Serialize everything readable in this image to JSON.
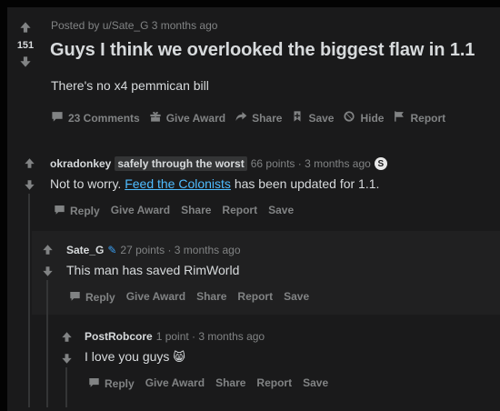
{
  "post": {
    "score": "151",
    "meta": "Posted by u/Sate_G 3 months ago",
    "title": "Guys I think we overlooked the biggest flaw in 1.1",
    "body": "There's no x4 pemmican bill",
    "actions": {
      "comments": "23 Comments",
      "award": "Give Award",
      "share": "Share",
      "save": "Save",
      "hide": "Hide",
      "report": "Report"
    }
  },
  "comments": [
    {
      "user": "okradonkey",
      "flair": "safely through the worst",
      "meta": "66 points · 3 months ago",
      "badge": "S",
      "text_before": "Not to worry. ",
      "link_text": "Feed the Colonists",
      "text_after": " has been updated for 1.1.",
      "actions": {
        "reply": "Reply",
        "award": "Give Award",
        "share": "Share",
        "report": "Report",
        "save": "Save"
      }
    },
    {
      "user": "Sate_G",
      "meta": "27 points · 3 months ago",
      "text": "This man has saved RimWorld",
      "actions": {
        "reply": "Reply",
        "award": "Give Award",
        "share": "Share",
        "report": "Report",
        "save": "Save"
      }
    },
    {
      "user": "PostRobcore",
      "meta": "1 point · 3 months ago",
      "text": "I love you guys",
      "emoji": "😸",
      "actions": {
        "reply": "Reply",
        "award": "Give Award",
        "share": "Share",
        "report": "Report",
        "save": "Save"
      }
    }
  ],
  "icons": {
    "upvote": "upvote-icon",
    "downvote": "downvote-icon",
    "comment": "comment-icon",
    "gift": "gift-icon",
    "share": "share-icon",
    "save": "bookmark-icon",
    "hide": "hide-icon",
    "report": "flag-icon"
  },
  "colors": {
    "background": "#1a1a1b",
    "text": "#d7dadc",
    "muted": "#818384",
    "link": "#4fbcff"
  }
}
